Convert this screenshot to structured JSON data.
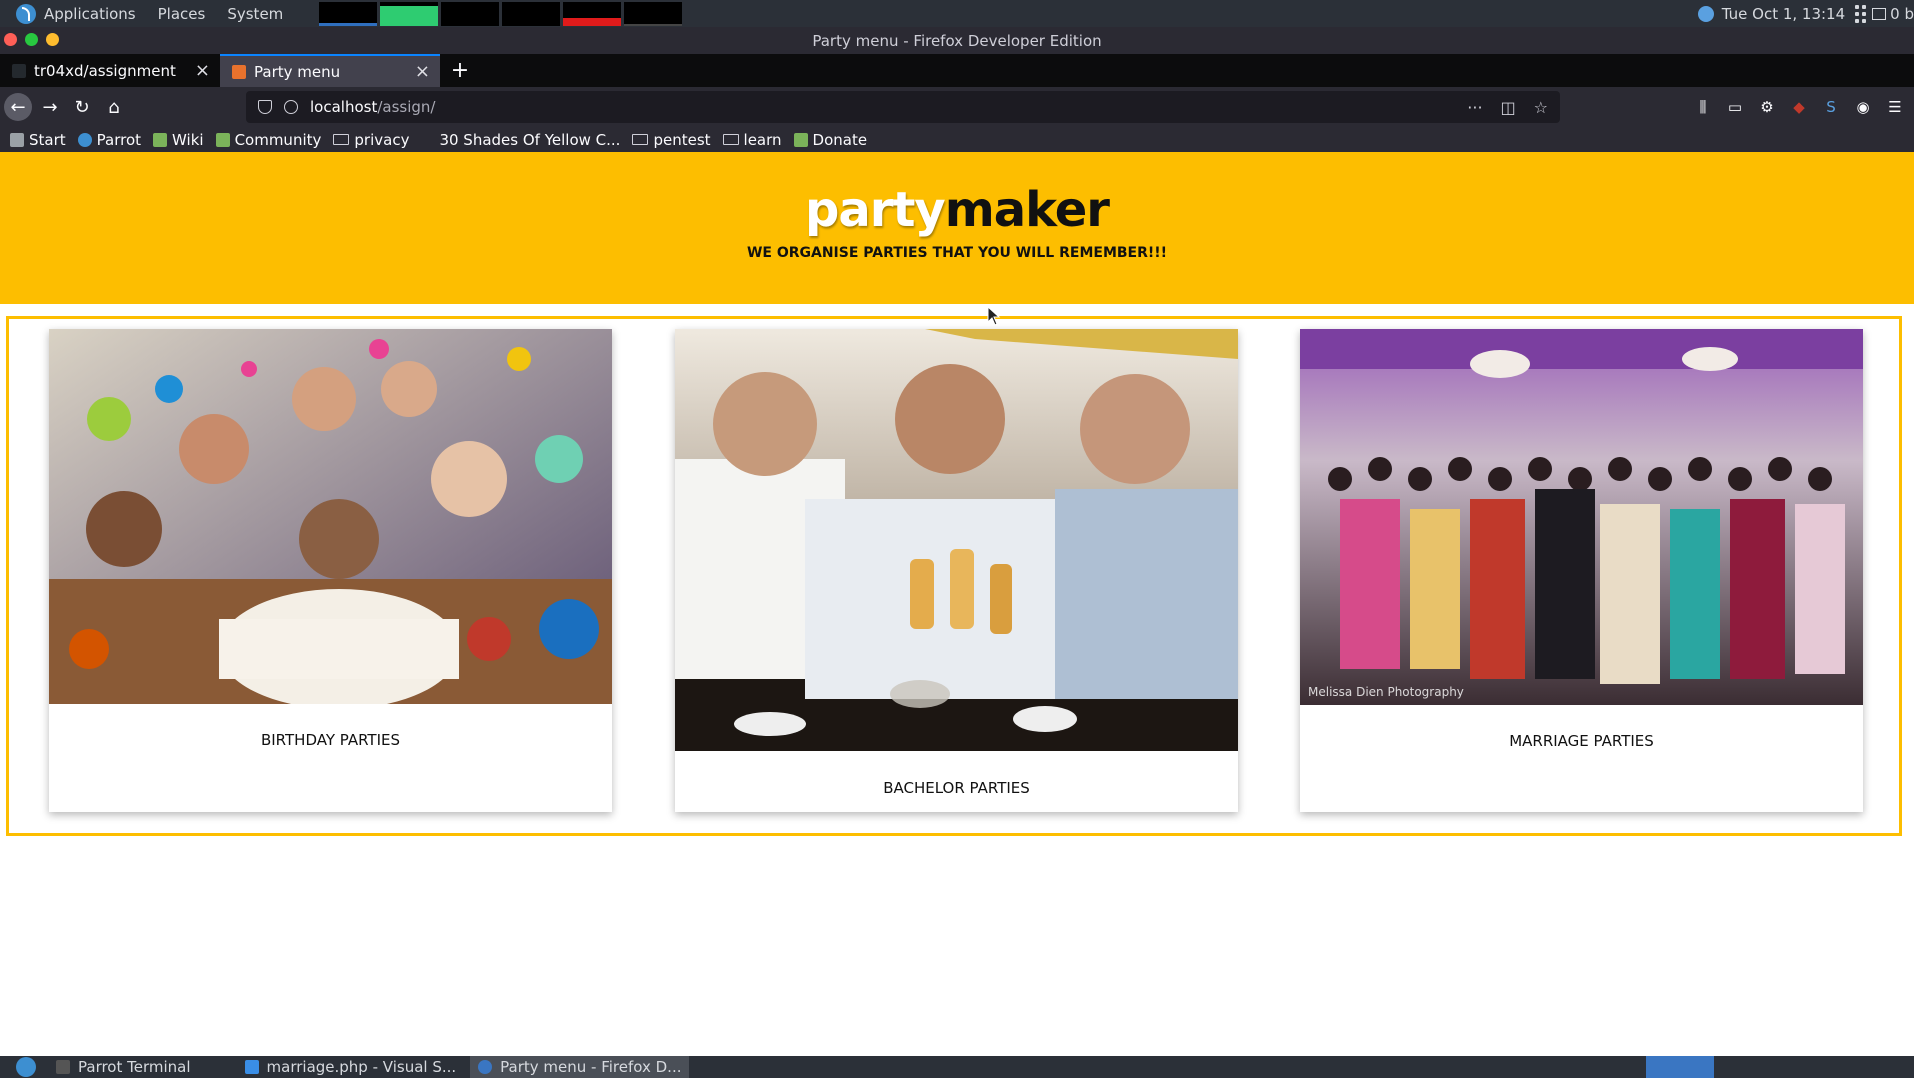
{
  "os_panel": {
    "menus": [
      "Applications",
      "Places",
      "System"
    ],
    "clock": "Tue Oct 1, 13:14",
    "net": "0 b"
  },
  "window": {
    "title": "Party menu - Firefox Developer Edition"
  },
  "tabs": [
    {
      "label": "tr04xd/assignment",
      "active": false
    },
    {
      "label": "Party menu",
      "active": true
    }
  ],
  "url": {
    "host": "localhost",
    "path": "/assign/"
  },
  "bookmarks": [
    {
      "label": "Start",
      "kind": "bookmark"
    },
    {
      "label": "Parrot",
      "kind": "bookmark"
    },
    {
      "label": "Wiki",
      "kind": "bookmark"
    },
    {
      "label": "Community",
      "kind": "bookmark"
    },
    {
      "label": "privacy",
      "kind": "folder"
    },
    {
      "label": "30 Shades Of Yellow C...",
      "kind": "bookmark"
    },
    {
      "label": "pentest",
      "kind": "folder"
    },
    {
      "label": "learn",
      "kind": "folder"
    },
    {
      "label": "Donate",
      "kind": "bookmark"
    }
  ],
  "hero": {
    "brand_part1": "party",
    "brand_part2": "maker",
    "tagline": "WE ORGANISE PARTIES THAT YOU WILL REMEMBER!!!"
  },
  "cards": [
    {
      "caption": "BIRTHDAY PARTIES",
      "image": "birthday-party-photo"
    },
    {
      "caption": "BACHELOR PARTIES",
      "image": "bachelor-party-photo"
    },
    {
      "caption": "MARRIAGE PARTIES",
      "image": "marriage-party-photo",
      "credit": "Melissa Dien Photography"
    }
  ],
  "taskbar": [
    {
      "label": "Parrot Terminal"
    },
    {
      "label": "marriage.php - Visual S..."
    },
    {
      "label": "Party menu - Firefox D..."
    }
  ],
  "colors": {
    "accent": "#fdbe00",
    "tab_highlight": "#0a84ff"
  }
}
